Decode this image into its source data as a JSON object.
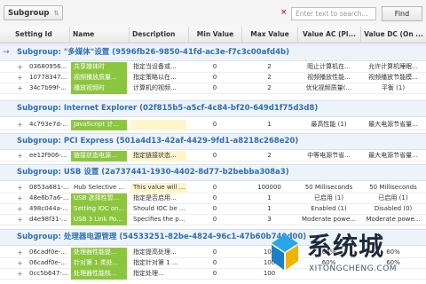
{
  "toolbar": {
    "group_chip": "Subgroup",
    "search_placeholder": "Enter text to search...",
    "find_label": "Find",
    "clear_glyph": "×"
  },
  "columns": [
    "Setting Id",
    "Name",
    "Description",
    "Min Value",
    "Max Value",
    "Value AC (Pl...",
    "Value DC (On ..."
  ],
  "groups": [
    {
      "label": "Subgroup: \"多媒体\"设置 (9596fb26-9850-41fd-ac3e-f7c3c00afd4b)",
      "rows": [
        {
          "id": "03680956...",
          "name": "共享媒体时",
          "desc": "指定当设备或...",
          "min": "0",
          "max": "2",
          "ac": "阻止计算机在...",
          "dc": "允许计算机睡眠..."
        },
        {
          "id": "10778347...",
          "name": "视频播放质量...",
          "desc": "指定策略以在...",
          "min": "0",
          "max": "2",
          "ac": "视频播放性能...",
          "dc": "视频播放节能模..."
        },
        {
          "id": "34c7b99f-...",
          "name": "播放视频时",
          "desc": "计算机的视频...",
          "min": "0",
          "max": "2",
          "ac": "优化视频质量(...",
          "dc": "平衡 (1)"
        }
      ]
    },
    {
      "label": "Subgroup: Internet Explorer (02f815b5-a5cf-4c84-bf20-649d1f75d3d8)",
      "rows": [
        {
          "id": "4c793e7d-...",
          "name": "JavaScript 计...",
          "desc": "",
          "min": "0",
          "max": "1",
          "ac": "最高性能 (1)",
          "dc": "最大电源节省量..."
        }
      ]
    },
    {
      "label": "Subgroup: PCI Express (501a4d13-42af-4429-9fd1-a8218c268e20)",
      "rows": [
        {
          "id": "ee12f906-...",
          "name": "链接状态电源...",
          "desc": "指定链接状态...",
          "min": "0",
          "max": "2",
          "ac": "中等电源节省...",
          "dc": "最大电源节省量..."
        }
      ]
    },
    {
      "label": "Subgroup: USB 设置 (2a737441-1930-4402-8d77-b2bebba308a3)",
      "rows": [
        {
          "id": "0853a681-...",
          "name": "Hub Selective ...",
          "desc": "This value will ...",
          "min": "0",
          "max": "100000",
          "ac": "50 Milliseconds",
          "dc": "50 Milliseconds"
        },
        {
          "id": "48e6b7a6-...",
          "name": "USB 选择性暂...",
          "desc": "指定是否启用...",
          "min": "0",
          "max": "1",
          "ac": "已启用 (1)",
          "dc": "已启用 (1)"
        },
        {
          "id": "498c044a-...",
          "name": "Setting IOC on...",
          "desc": "Should IOC be ...",
          "min": "0",
          "max": "1",
          "ac": "Enabled (1)",
          "dc": "Disabled (0)"
        },
        {
          "id": "d4e98f31-...",
          "name": "USB 3 Link Po...",
          "desc": "Specifies the p...",
          "min": "0",
          "max": "3",
          "ac": "Moderate powe...",
          "dc": "Moderate powe..."
        }
      ]
    },
    {
      "label": "Subgroup: 处理器电源管理 (54533251-82be-4824-96c1-47b60b740d00)",
      "rows": [
        {
          "id": "06cadf0e-...",
          "name": "处理器性能提...",
          "desc": "指定提高处理...",
          "min": "0",
          "max": "100",
          "ac": "60%",
          "dc": "60%"
        },
        {
          "id": "06cadf0e-...",
          "name": "针对第 1 类处...",
          "desc": "指定针对第 1 ...",
          "min": "0",
          "max": "100",
          "ac": "60%",
          "dc": "60%"
        },
        {
          "id": "0cc5b647-...",
          "name": "处理器性能核...",
          "desc": "指定处理...",
          "min": "0",
          "max": "100",
          "ac": "",
          "dc": ""
        }
      ]
    }
  ],
  "watermark": {
    "text": "系统城",
    "sub": "XITONGCHENG.COM"
  },
  "colors": {
    "accent": "#2d6fb3",
    "highlight": "#8cc63e"
  }
}
